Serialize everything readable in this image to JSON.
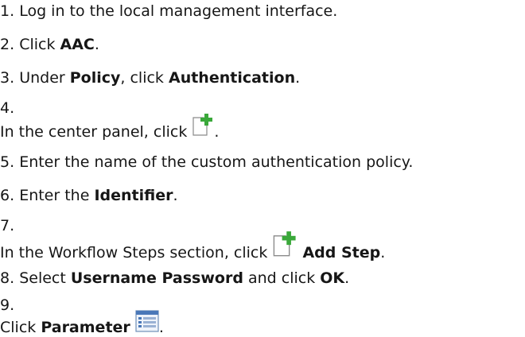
{
  "steps": [
    {
      "num": "1.",
      "text": "Log in to the local management interface."
    },
    {
      "num": "2.",
      "pre": "Click ",
      "bold1": "AAC",
      "post": "."
    },
    {
      "num": "3.",
      "pre": "Under ",
      "bold1": "Policy",
      "mid": ", click ",
      "bold2": "Authentication",
      "post": "."
    },
    {
      "num": "4.",
      "pre": "In the center panel, click ",
      "icon": "add-document-icon",
      "post": "."
    },
    {
      "num": "5.",
      "text": "Enter the name of the custom authentication policy."
    },
    {
      "num": "6.",
      "pre": "Enter the ",
      "bold1": "Identifier",
      "post": "."
    },
    {
      "num": "7.",
      "pre": "In the Workflow Steps section, click ",
      "icon": "add-document-icon",
      "bold1": "Add Step",
      "post": "."
    },
    {
      "num": "8.",
      "pre": "Select ",
      "bold1": "Username Password",
      "mid": " and click ",
      "bold2": "OK",
      "post": "."
    },
    {
      "num": "9.",
      "pre": "Click ",
      "bold1": "Parameter",
      "icon": "parameter-list-icon",
      "post": "."
    }
  ],
  "colors": {
    "text": "#161616",
    "icon_green": "#3aa83a",
    "icon_blue": "#4a78b8"
  }
}
